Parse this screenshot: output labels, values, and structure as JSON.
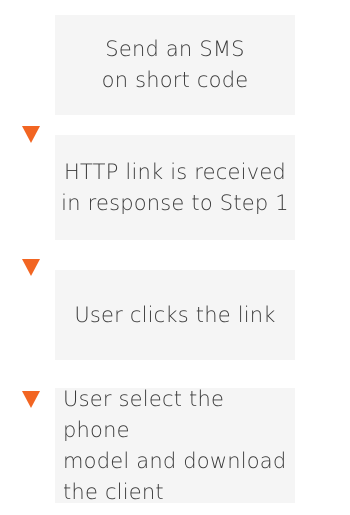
{
  "steps": [
    {
      "text": "Send an SMS\non short code"
    },
    {
      "text": "HTTP link is received\nin response to Step 1"
    },
    {
      "text": "User clicks the link"
    },
    {
      "text": "User select the phone\nmodel and download\nthe client"
    }
  ],
  "colors": {
    "arrow": "#f26522",
    "box_background": "#f5f5f5",
    "text": "#3a3a3a"
  },
  "icons": {
    "arrow": "triangle-down-icon"
  }
}
